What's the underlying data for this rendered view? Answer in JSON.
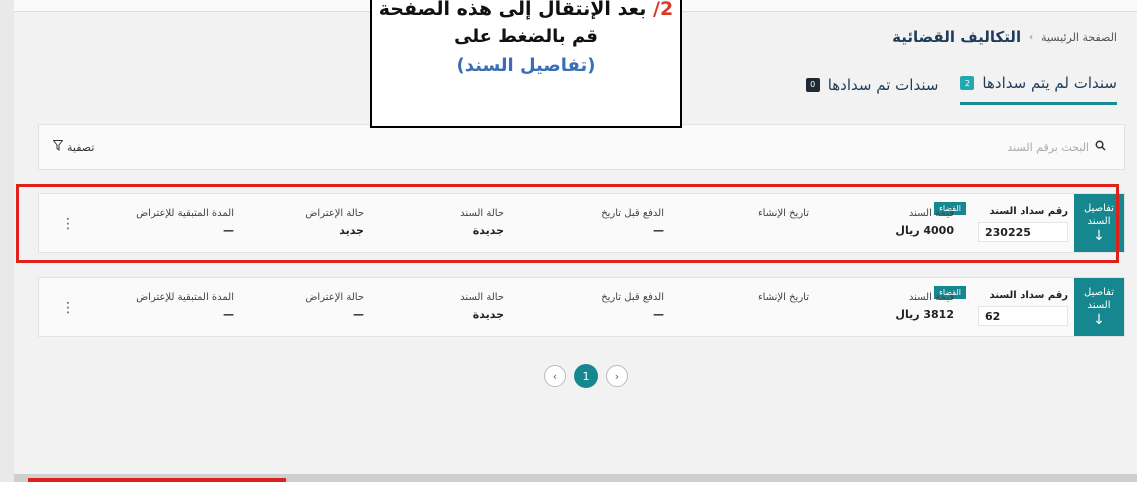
{
  "breadcrumb": {
    "home": "الصفحة الرئيسية",
    "separator": "›",
    "current": "التكاليف القضائية"
  },
  "tabs": [
    {
      "label": "سندات لم يتم سدادها",
      "count": "2"
    },
    {
      "label": "سندات تم سدادها",
      "count": "0"
    }
  ],
  "callout": {
    "number": "2/",
    "line1": "بعد الإنتقال إلى هذه الصفحة",
    "line2": "قم بالضغط على",
    "line3": "(تفاصيل السند)"
  },
  "search": {
    "placeholder": "البحث برقم السند",
    "filter_label": "تصفية"
  },
  "cards": [
    {
      "details_label": "تفاصيل السند",
      "number_label": "رقم سداد السند",
      "number": "230225",
      "court_tag": "القضاء",
      "amount_label": "قيمة السند",
      "amount": "4000 ريال",
      "created_label": "تاريخ الإنشاء",
      "created": "",
      "pay_before_label": "الدفع قبل تاريخ",
      "pay_before": "—",
      "status_label": "حالة السند",
      "status": "جديدة",
      "objection_label": "حالة الإعتراض",
      "objection": "جديد",
      "remaining_label": "المدة المتبقية للإعتراض",
      "remaining": "—"
    },
    {
      "details_label": "تفاصيل السند",
      "number_label": "رقم سداد السند",
      "number": "62",
      "court_tag": "القضاء",
      "amount_label": "قيمة السند",
      "amount": "3812 ريال",
      "created_label": "تاريخ الإنشاء",
      "created": "",
      "pay_before_label": "الدفع قبل تاريخ",
      "pay_before": "—",
      "status_label": "حالة السند",
      "status": "جديدة",
      "objection_label": "حالة الإعتراض",
      "objection": "—",
      "remaining_label": "المدة المتبقية للإعتراض",
      "remaining": "—"
    }
  ],
  "pagination": {
    "current": "1"
  },
  "icons": {
    "search": "search-icon",
    "filter": "filter-icon",
    "kebab": "kebab-menu-icon",
    "arrow_down": "arrow-down-icon",
    "prev": "chevron-left-icon",
    "next": "chevron-right-icon"
  },
  "colors": {
    "accent": "#17878f",
    "highlight": "#e0201b",
    "title": "#1f3d5a"
  }
}
